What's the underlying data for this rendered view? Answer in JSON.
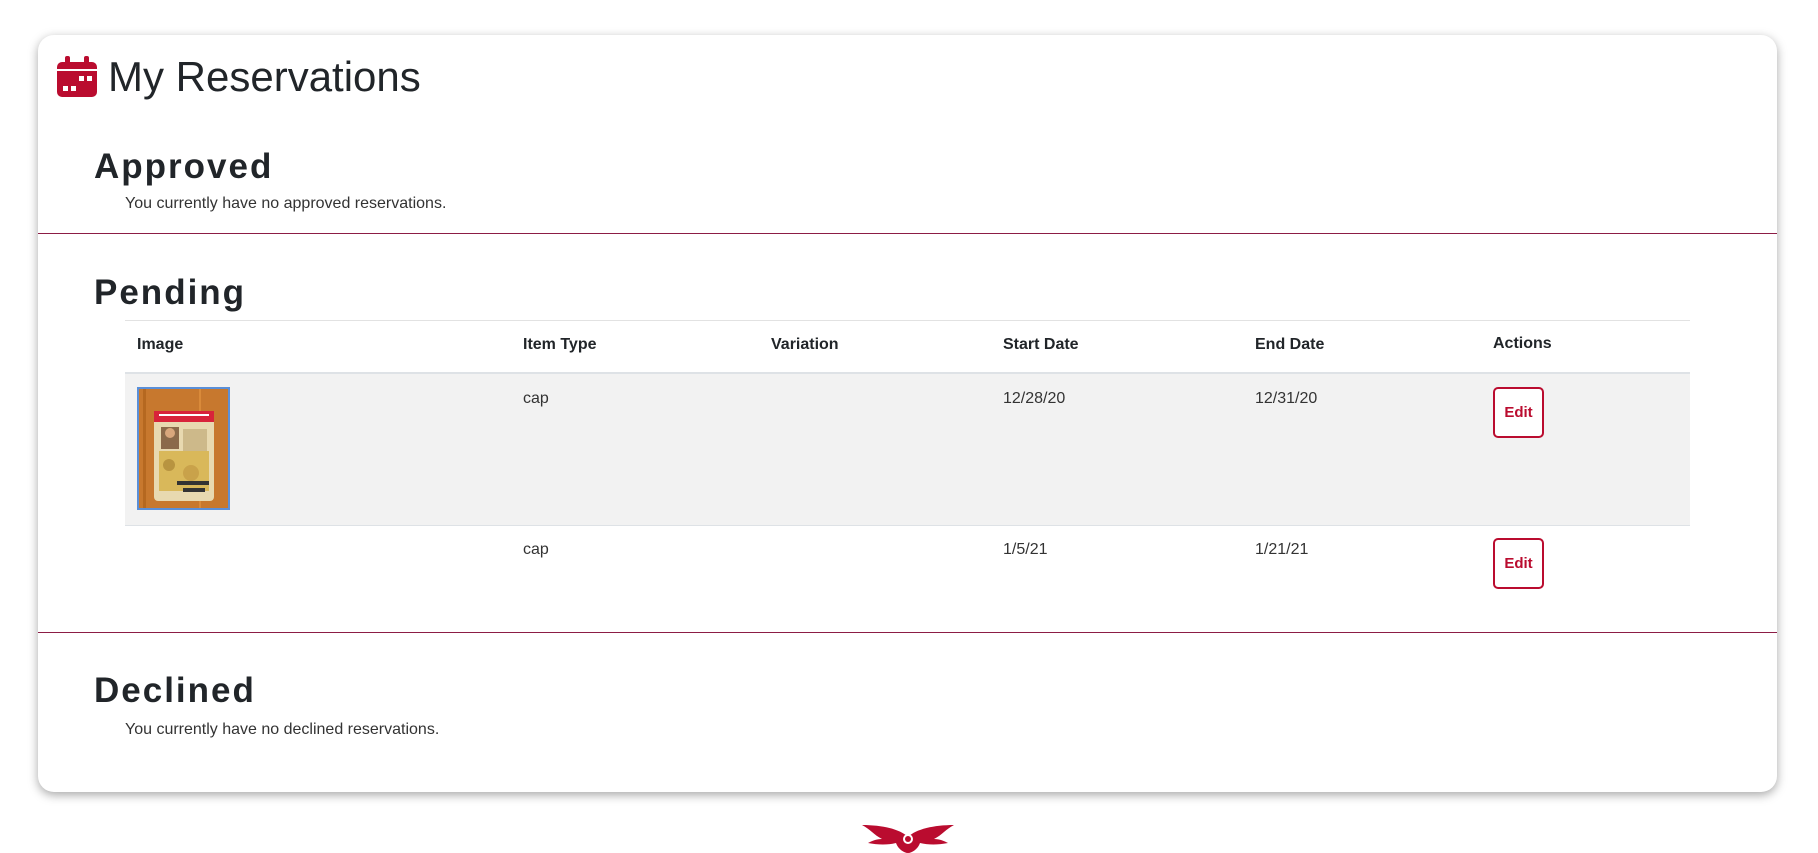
{
  "page": {
    "title": "My Reservations",
    "icon": "calendar-icon"
  },
  "colors": {
    "accent": "#ba0c2f",
    "divider": "#8c1d45",
    "striped_row": "#f2f2f2"
  },
  "approved": {
    "title": "Approved",
    "empty_message": "You currently have no approved reservations."
  },
  "pending": {
    "title": "Pending",
    "columns": [
      "Image",
      "Item Type",
      "Variation",
      "Start Date",
      "End Date",
      "Actions"
    ],
    "rows": [
      {
        "has_image": true,
        "item_type": "cap",
        "variation": "",
        "start_date": "12/28/20",
        "end_date": "12/31/20",
        "action": "Edit"
      },
      {
        "has_image": false,
        "item_type": "cap",
        "variation": "",
        "start_date": "1/5/21",
        "end_date": "1/21/21",
        "action": "Edit"
      }
    ]
  },
  "declined": {
    "title": "Declined",
    "empty_message": "You currently have no declined reservations."
  },
  "footer": {
    "logo_icon": "cardinal-logo-icon"
  }
}
